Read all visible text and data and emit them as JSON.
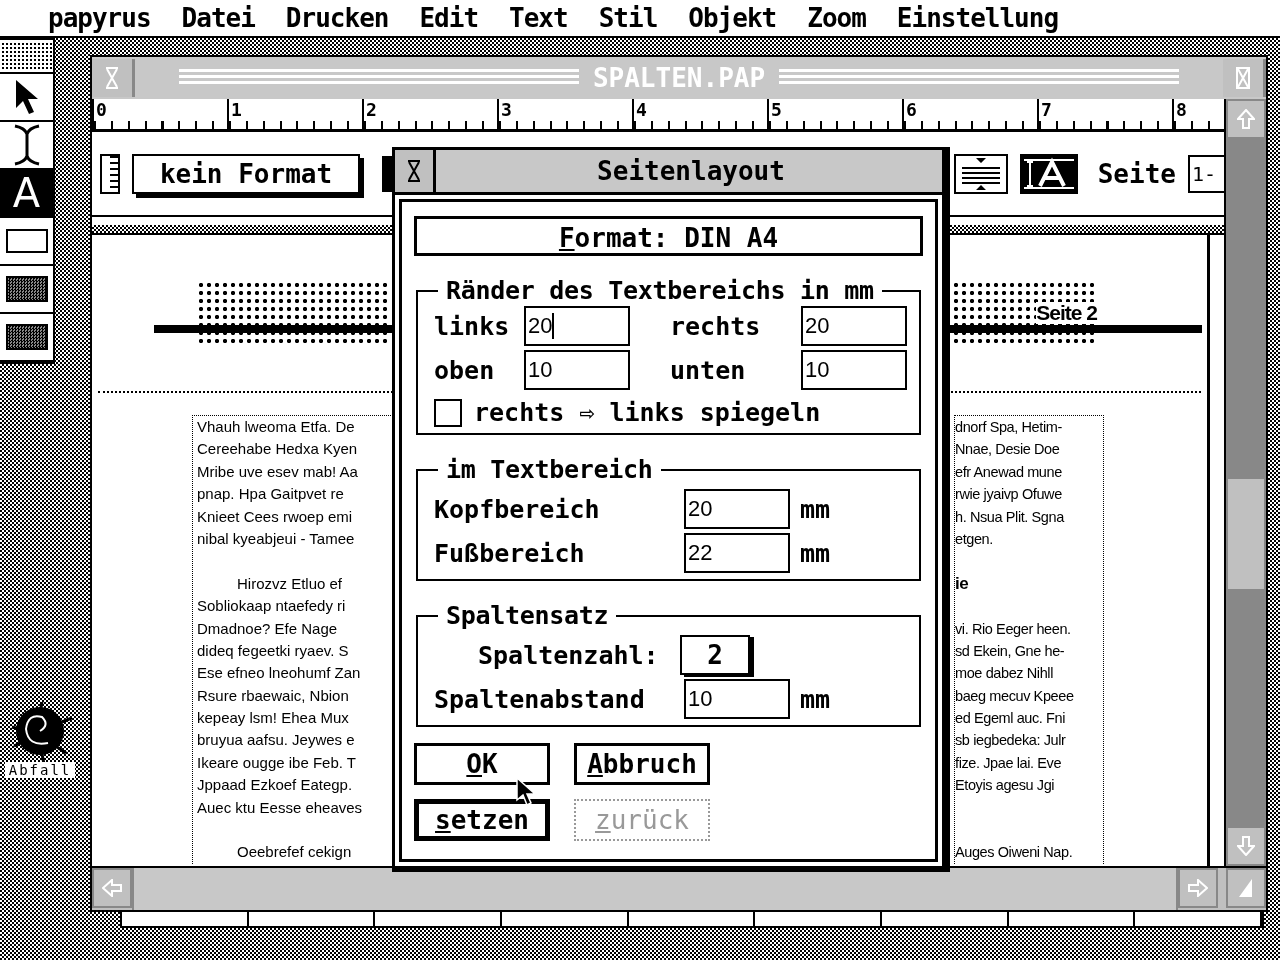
{
  "menu_bar": [
    "papyrus",
    "Datei",
    "Drucken",
    "Edit",
    "Text",
    "Stil",
    "Objekt",
    "Zoom",
    "Einstellung"
  ],
  "tools": [
    {
      "kind": "pattern",
      "selected": false
    },
    {
      "kind": "arrow",
      "selected": false
    },
    {
      "kind": "ibeam",
      "selected": false
    },
    {
      "kind": "letter",
      "label": "A",
      "selected": true
    },
    {
      "kind": "rect",
      "selected": false
    },
    {
      "kind": "fill",
      "selected": false
    },
    {
      "kind": "fill",
      "selected": false
    }
  ],
  "trash": {
    "label": "Abfall"
  },
  "window": {
    "title": "SPALTEN.PAP",
    "ruler": [
      "0",
      "1",
      "2",
      "3",
      "4",
      "5",
      "6",
      "7",
      "8"
    ],
    "toolbar": {
      "format": "kein Format",
      "page_label": "Seite",
      "page_value": "1-"
    },
    "document": {
      "header": "Seite 2",
      "left_column": [
        {
          "kind": "line",
          "text": "Vhauh lweoma Etfa. De"
        },
        {
          "kind": "line",
          "text": "Cereehabe Hedxa Kyen"
        },
        {
          "kind": "line",
          "text": "Mribe uve esev mab! Aa"
        },
        {
          "kind": "line",
          "text": "pnap. Hpa Gaitpvet re"
        },
        {
          "kind": "line",
          "text": "Knieet Cees rwoep emi"
        },
        {
          "kind": "line",
          "text": "nibal kyeabjeui - Tamee"
        },
        {
          "kind": "blank"
        },
        {
          "kind": "indent",
          "text": "Hirozvz Etluo ef"
        },
        {
          "kind": "line",
          "text": "Sobliokaap ntaefedy ri"
        },
        {
          "kind": "line",
          "text": "Dmadnoe? Efe Nage"
        },
        {
          "kind": "line",
          "text": "dideq fegeetki ryaev. S"
        },
        {
          "kind": "line",
          "text": "Ese efneo lneohumf Zan"
        },
        {
          "kind": "line",
          "text": "Rsure rbaewaic, Nbion"
        },
        {
          "kind": "line",
          "text": "kepeay lsm! Ehea Mux"
        },
        {
          "kind": "line",
          "text": "bruyua aafsu. Jeywes e"
        },
        {
          "kind": "line",
          "text": "Ikeare ougge ibe Feb. T"
        },
        {
          "kind": "line",
          "text": "Jppaad Ezkoef Eategp."
        },
        {
          "kind": "line",
          "text": "Auec ktu Eesse eheaves"
        },
        {
          "kind": "blank"
        },
        {
          "kind": "indent",
          "text": "Oeebrefef cekign"
        }
      ],
      "right_column": [
        {
          "kind": "line",
          "text": "dnorf Spa, Hetim-"
        },
        {
          "kind": "line",
          "text": "Nnae, Desie Doe"
        },
        {
          "kind": "line",
          "text": "efr Anewad mune"
        },
        {
          "kind": "line",
          "text": "rwie jyaivp Ofuwe"
        },
        {
          "kind": "line",
          "text": "h. Nsua Plit. Sgna"
        },
        {
          "kind": "line",
          "text": "etgen."
        },
        {
          "kind": "blank"
        },
        {
          "kind": "heading",
          "text": "ie"
        },
        {
          "kind": "blank"
        },
        {
          "kind": "line",
          "text": "vi. Rio Eeger heen."
        },
        {
          "kind": "line",
          "text": "sd Ekein, Gne he-"
        },
        {
          "kind": "line",
          "text": "moe dabez Nihll"
        },
        {
          "kind": "line",
          "text": "baeg mecuv Kpeee"
        },
        {
          "kind": "line",
          "text": "ed Egeml auc. Fni"
        },
        {
          "kind": "line",
          "text": "sb iegbedeka: Julr"
        },
        {
          "kind": "line",
          "text": "fize. Jpae lai. Eve"
        },
        {
          "kind": "line",
          "text": "Etoyis agesu Jgi"
        },
        {
          "kind": "blank"
        },
        {
          "kind": "blank"
        },
        {
          "kind": "line",
          "text": "Auges Oiweni Nap."
        }
      ]
    }
  },
  "dialog": {
    "title": "Seitenlayout",
    "format": {
      "label": "Format: DIN A4",
      "hotkey": true
    },
    "margins": {
      "title": "Ränder des Textbereichs in mm",
      "fields": [
        {
          "label": "links",
          "value": "20",
          "focused": true
        },
        {
          "label": "rechts",
          "value": "20",
          "focused": false
        },
        {
          "label": "oben",
          "value": "10",
          "focused": false
        },
        {
          "label": "unten",
          "value": "10",
          "focused": false
        }
      ],
      "mirror": {
        "label": "rechts ⇨ links spiegeln",
        "checked": false
      }
    },
    "text_area": {
      "title": "im Textbereich",
      "fields": [
        {
          "label": "Kopfbereich",
          "value": "20",
          "unit": "mm"
        },
        {
          "label": "Fußbereich",
          "value": "22",
          "unit": "mm"
        }
      ]
    },
    "columns": {
      "title": "Spaltensatz",
      "count_label": "Spaltenzahl:",
      "count": "2",
      "gap": {
        "label": "Spaltenabstand",
        "value": "10",
        "unit": "mm"
      }
    },
    "buttons": [
      {
        "label": "OK",
        "default": false,
        "disabled": false,
        "hotkey": true
      },
      {
        "label": "Abbruch",
        "default": false,
        "disabled": false,
        "hotkey": true
      },
      {
        "label": "setzen",
        "default": true,
        "disabled": false,
        "hotkey": true
      },
      {
        "label": "zurück",
        "default": false,
        "disabled": true,
        "hotkey": true
      }
    ]
  }
}
